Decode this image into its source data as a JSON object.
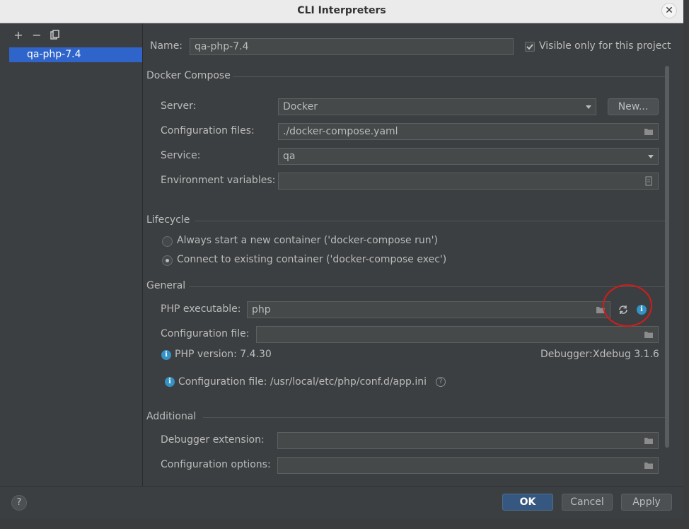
{
  "window": {
    "title": "CLI Interpreters"
  },
  "sidebar": {
    "tools": [
      {
        "name": "add",
        "glyph": "+"
      },
      {
        "name": "remove",
        "glyph": "−"
      },
      {
        "name": "copy",
        "glyph": "⧉"
      }
    ],
    "items": [
      {
        "label": "qa-php-7.4",
        "selected": true
      }
    ]
  },
  "header": {
    "name_label": "Name:",
    "name_value": "qa-php-7.4",
    "visible_only_label": "Visible only for this project",
    "visible_only_checked": true
  },
  "docker_compose": {
    "title": "Docker Compose",
    "server_label": "Server:",
    "server_value": "Docker",
    "new_button": "New...",
    "config_files_label": "Configuration files:",
    "config_files_value": "./docker-compose.yaml",
    "service_label": "Service:",
    "service_value": "qa",
    "env_vars_label": "Environment variables:",
    "env_vars_value": ""
  },
  "lifecycle": {
    "title": "Lifecycle",
    "option_run": "Always start a new container ('docker-compose run')",
    "option_exec": "Connect to existing container ('docker-compose exec')",
    "selected": "exec"
  },
  "general": {
    "title": "General",
    "php_exec_label": "PHP executable:",
    "php_exec_value": "php",
    "config_file_label": "Configuration file:",
    "config_file_value": "",
    "php_version": "PHP version: 7.4.30",
    "debugger_label": "Debugger:",
    "debugger_value": "Xdebug 3.1.6",
    "config_file_info": "Configuration file: /usr/local/etc/php/conf.d/app.ini"
  },
  "additional": {
    "title": "Additional",
    "debugger_ext_label": "Debugger extension:",
    "debugger_ext_value": "",
    "config_options_label": "Configuration options:",
    "config_options_value": ""
  },
  "footer": {
    "help": "?",
    "ok": "OK",
    "cancel": "Cancel",
    "apply": "Apply"
  },
  "colors": {
    "accent": "#2f65ca",
    "primary_button": "#365880",
    "annotation": "#d21c1c"
  }
}
